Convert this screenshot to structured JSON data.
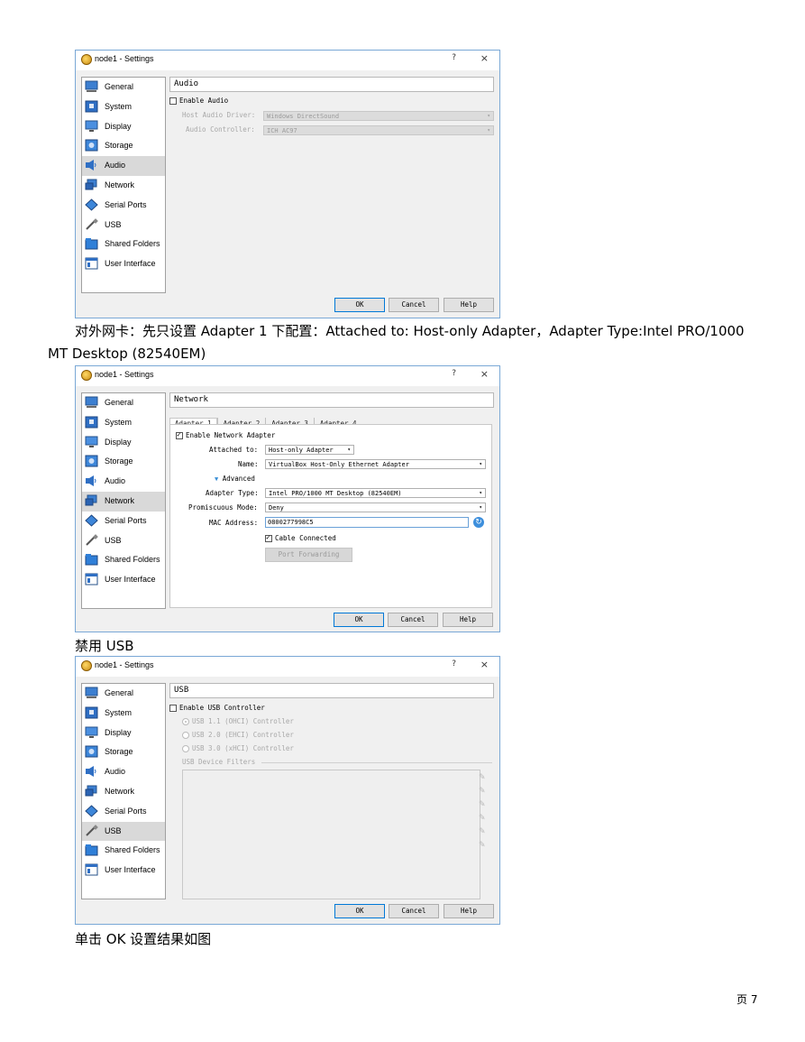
{
  "window_title": "node1 - Settings",
  "help_mark": "?",
  "close_mark": "×",
  "sidebar_items": [
    "General",
    "System",
    "Display",
    "Storage",
    "Audio",
    "Network",
    "Serial Ports",
    "USB",
    "Shared Folders",
    "User Interface"
  ],
  "icons": {
    "General": "general-icon",
    "System": "system-icon",
    "Display": "display-icon",
    "Storage": "storage-icon",
    "Audio": "audio-icon",
    "Network": "network-icon",
    "Serial Ports": "serial-ports-icon",
    "USB": "usb-icon",
    "Shared Folders": "shared-folders-icon",
    "User Interface": "user-interface-icon"
  },
  "buttons": {
    "ok": "OK",
    "cancel": "Cancel",
    "help": "Help"
  },
  "audio": {
    "title": "Audio",
    "enable_label": "Enable Audio",
    "host_driver_label": "Host Audio Driver:",
    "host_driver_value": "Windows DirectSound",
    "controller_label": "Audio Controller:",
    "controller_value": "ICH AC97"
  },
  "caption1": "对外网卡：先只设置 Adapter 1 下配置：Attached to: Host-only Adapter，Adapter Type:Intel PRO/1000",
  "caption1b": "MT Desktop (82540EM)",
  "network": {
    "title": "Network",
    "tabs": [
      "Adapter 1",
      "Adapter 2",
      "Adapter 3",
      "Adapter 4"
    ],
    "enable_label": "Enable Network Adapter",
    "attached_label": "Attached to:",
    "attached_value": "Host-only Adapter",
    "name_label": "Name:",
    "name_value": "VirtualBox Host-Only Ethernet Adapter",
    "advanced_label": "Advanced",
    "adapter_type_label": "Adapter Type:",
    "adapter_type_value": "Intel PRO/1000 MT Desktop (82540EM)",
    "promiscuous_label": "Promiscuous Mode:",
    "promiscuous_value": "Deny",
    "mac_label": "MAC Address:",
    "mac_value": "0800277998C5",
    "cable_label": "Cable Connected",
    "port_forwarding_label": "Port Forwarding"
  },
  "caption2": "禁用 USB",
  "usb": {
    "title": "USB",
    "enable_label": "Enable USB Controller",
    "usb1_label": "USB 1.1 (OHCI) Controller",
    "usb2_label": "USB 2.0 (EHCI) Controller",
    "usb3_label": "USB 3.0 (xHCI) Controller",
    "filters_label": "USB Device Filters"
  },
  "caption3": "单击 OK 设置结果如图",
  "page_number": "页 7",
  "colors": {
    "accent": "#0078d7",
    "selected": "#d9d9d9",
    "window_border": "#7aa8d6"
  }
}
